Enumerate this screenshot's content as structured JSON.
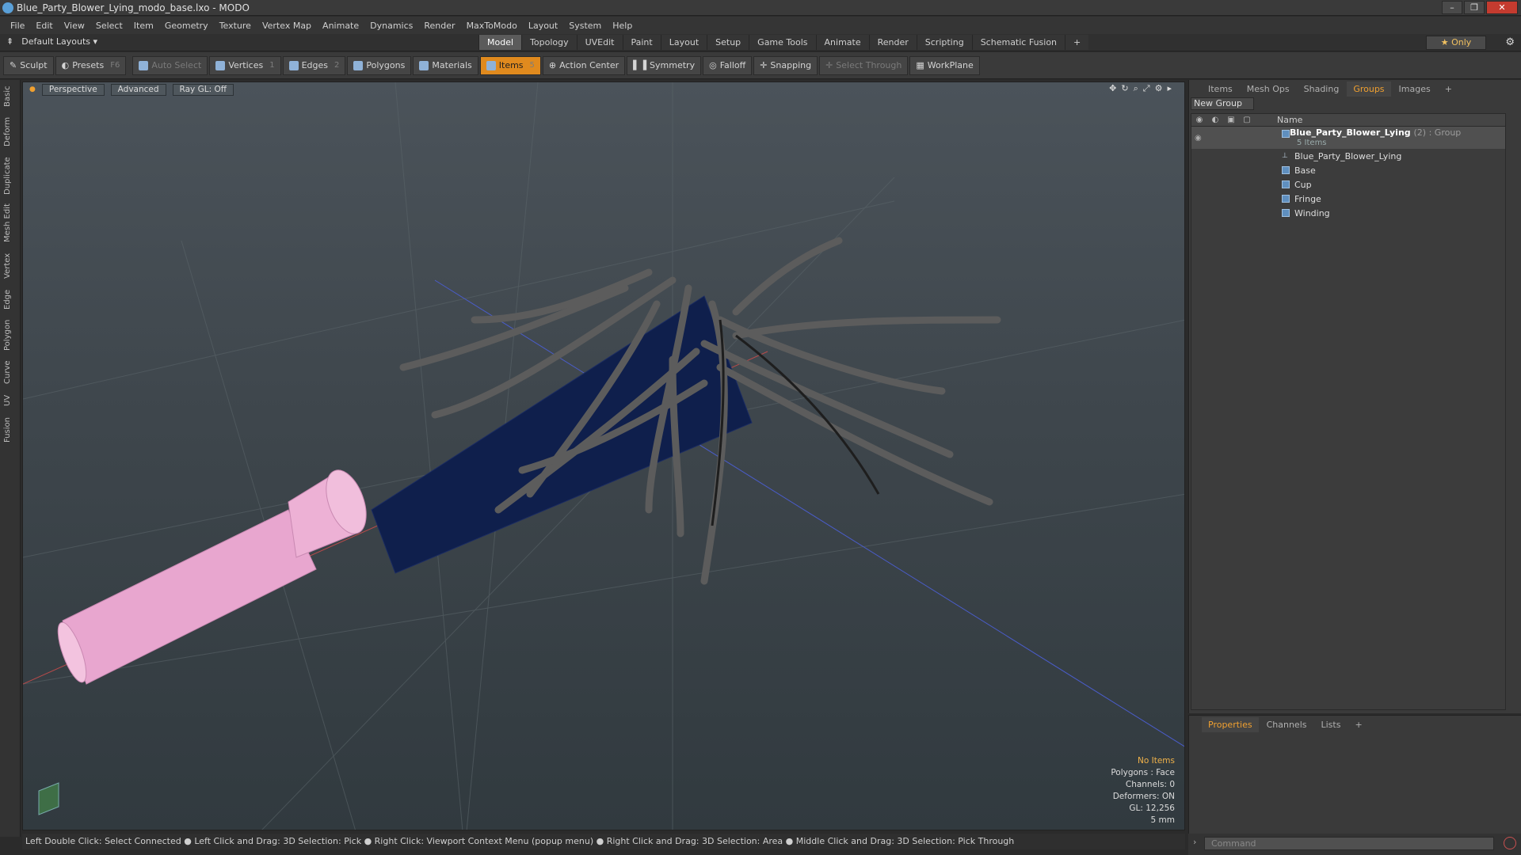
{
  "window": {
    "title": "Blue_Party_Blower_Lying_modo_base.lxo - MODO"
  },
  "menu": [
    "File",
    "Edit",
    "View",
    "Select",
    "Item",
    "Geometry",
    "Texture",
    "Vertex Map",
    "Animate",
    "Dynamics",
    "Render",
    "MaxToModo",
    "Layout",
    "System",
    "Help"
  ],
  "layout": {
    "label": "Default Layouts"
  },
  "mode_tabs": [
    "Model",
    "Topology",
    "UVEdit",
    "Paint",
    "Layout",
    "Setup",
    "Game Tools",
    "Animate",
    "Render",
    "Scripting",
    "Schematic Fusion"
  ],
  "only_label": "Only",
  "toolbar": {
    "sculpt": "Sculpt",
    "presets": "Presets",
    "presets_key": "F6",
    "auto_select": "Auto Select",
    "vertices": "Vertices",
    "vertices_count": "1",
    "edges": "Edges",
    "edges_count": "2",
    "polygons": "Polygons",
    "materials": "Materials",
    "items": "Items",
    "items_count": "5",
    "action_center": "Action Center",
    "symmetry": "Symmetry",
    "falloff": "Falloff",
    "snapping": "Snapping",
    "select_through": "Select Through",
    "workplane": "WorkPlane"
  },
  "left_tabs": [
    "Basic",
    "Deform",
    "Duplicate",
    "Mesh Edit",
    "Vertex",
    "Edge",
    "Polygon",
    "Curve",
    "UV",
    "Fusion"
  ],
  "viewport": {
    "view": "Perspective",
    "shading": "Advanced",
    "raygl": "Ray GL: Off",
    "info": {
      "items": "No Items",
      "polygons": "Polygons : Face",
      "channels": "Channels: 0",
      "deformers": "Deformers: ON",
      "gl": "GL: 12,256",
      "scale": "5 mm"
    }
  },
  "hint": "Left Double Click: Select Connected ● Left Click and Drag: 3D Selection: Pick ● Right Click: Viewport Context Menu (popup menu) ● Right Click and Drag: 3D Selection: Area ● Middle Click and Drag: 3D Selection: Pick Through",
  "right_tabs": [
    "Items",
    "Mesh Ops",
    "Shading",
    "Groups",
    "Images"
  ],
  "groups": {
    "new_group": "New Group",
    "col_name": "Name",
    "group_name": "Blue_Party_Blower_Lying",
    "group_tag": "(2) : Group",
    "group_sub": "5 Items",
    "children": [
      "Blue_Party_Blower_Lying",
      "Base",
      "Cup",
      "Fringe",
      "Winding"
    ]
  },
  "bottom_tabs": [
    "Properties",
    "Channels",
    "Lists"
  ],
  "command_placeholder": "Command",
  "colors": {
    "accent": "#e08a1e",
    "pink_mouthpiece": "#e8a6cf",
    "blue_body": "#0f1f4c",
    "fringe": "#5a5a5a"
  }
}
